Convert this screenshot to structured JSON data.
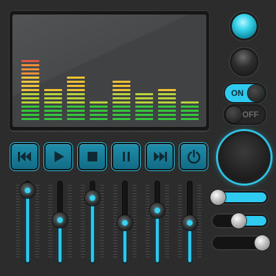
{
  "equalizer": {
    "levels": [
      {
        "band": 1,
        "level": 15,
        "peak": 15
      },
      {
        "band": 2,
        "level": 8
      },
      {
        "band": 3,
        "level": 11
      },
      {
        "band": 4,
        "level": 5
      },
      {
        "band": 5,
        "level": 10
      },
      {
        "band": 6,
        "level": 7
      },
      {
        "band": 7,
        "level": 8
      },
      {
        "band": 8,
        "level": 5
      }
    ],
    "max_segments": 16,
    "colors": {
      "low": "#35c83b",
      "mid": "#b8d43a",
      "high": "#f0c232",
      "top": "#f08a2e",
      "peak": "#e04a35"
    }
  },
  "indicators": [
    {
      "name": "indicator-light-on",
      "state": "on"
    },
    {
      "name": "indicator-light-off",
      "state": "off"
    }
  ],
  "toggles": {
    "on": {
      "label": "ON",
      "state": "on"
    },
    "off": {
      "label": "OFF",
      "state": "off"
    }
  },
  "transport": {
    "buttons": [
      {
        "name": "skip-back-button",
        "icon": "skip-back-icon"
      },
      {
        "name": "play-button",
        "icon": "play-icon"
      },
      {
        "name": "stop-button",
        "icon": "stop-icon"
      },
      {
        "name": "pause-button",
        "icon": "pause-icon"
      },
      {
        "name": "skip-forward-button",
        "icon": "skip-forward-icon"
      },
      {
        "name": "power-button",
        "icon": "power-icon"
      }
    ]
  },
  "knob": {
    "name": "volume-knob"
  },
  "vertical_sliders": [
    {
      "channel": 1,
      "value": 0.93
    },
    {
      "channel": 2,
      "value": 0.53
    },
    {
      "channel": 3,
      "value": 0.82
    },
    {
      "channel": 4,
      "value": 0.49
    },
    {
      "channel": 5,
      "value": 0.66
    },
    {
      "channel": 6,
      "value": 0.49
    }
  ],
  "horizontal_sliders": [
    {
      "value": 0.97
    },
    {
      "value": 0.53
    },
    {
      "value": 0.03
    }
  ],
  "accent_color": "#2ecaf0"
}
